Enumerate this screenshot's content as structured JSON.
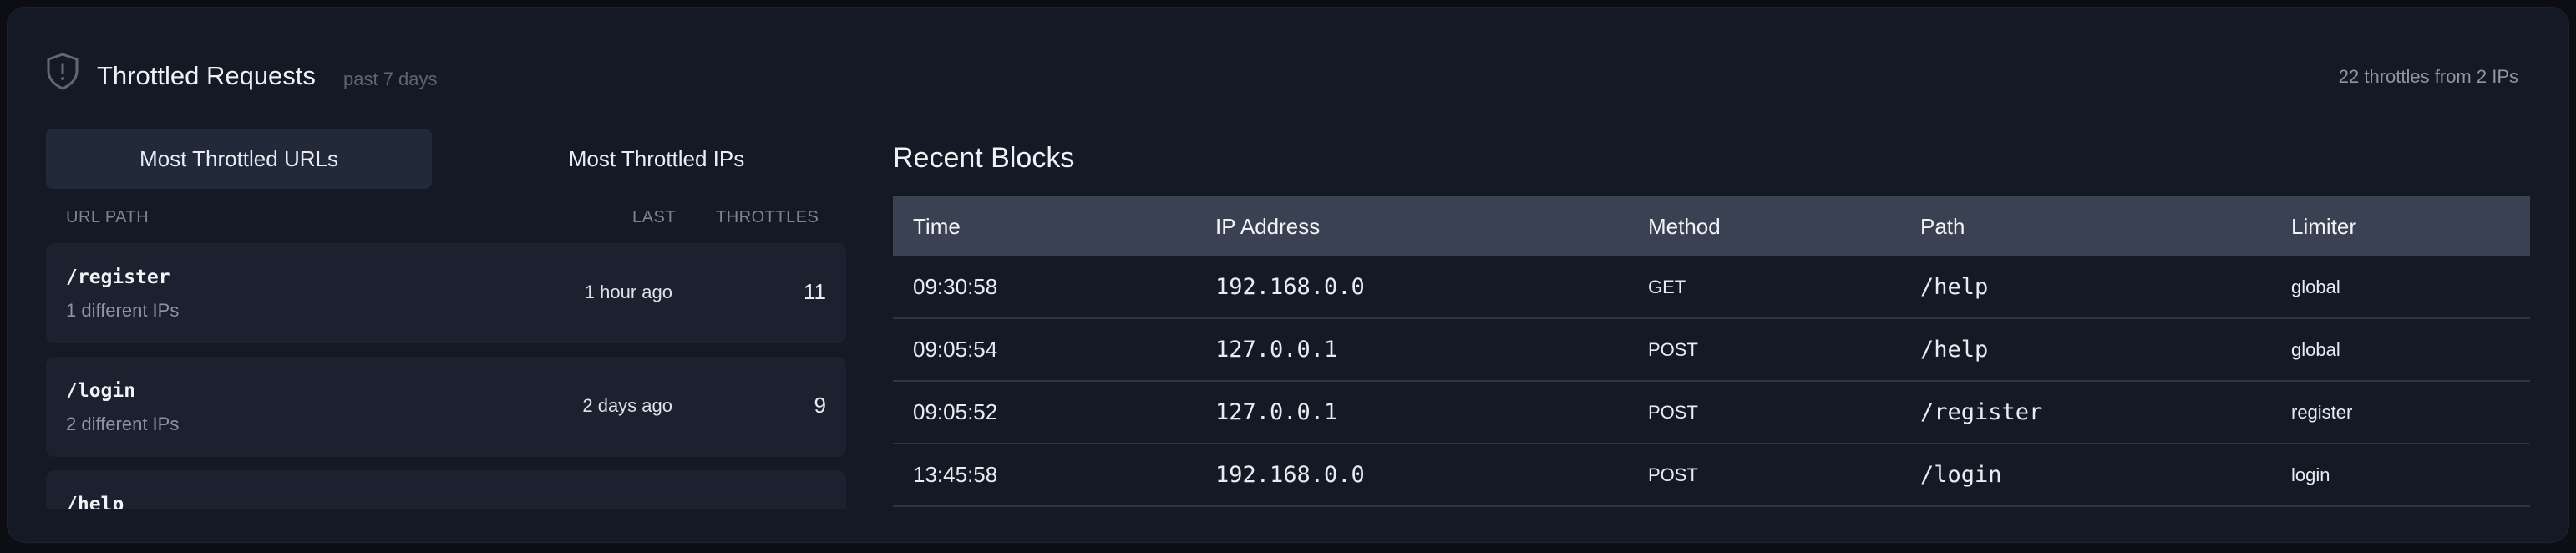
{
  "header": {
    "title": "Throttled Requests",
    "subtitle": "past 7 days",
    "summary": "22 throttles from 2 IPs",
    "icon": "shield-alert-icon"
  },
  "tabs": [
    {
      "label": "Most Throttled URLs",
      "active": true
    },
    {
      "label": "Most Throttled IPs",
      "active": false
    }
  ],
  "list": {
    "columns": {
      "path": "URL PATH",
      "last": "LAST",
      "throttles": "THROTTLES"
    },
    "items": [
      {
        "path": "/register",
        "ips": "1 different IPs",
        "last": "1 hour ago",
        "count": "11"
      },
      {
        "path": "/login",
        "ips": "2 different IPs",
        "last": "2 days ago",
        "count": "9"
      },
      {
        "path": "/help",
        "ips": "",
        "last": "",
        "count": ""
      }
    ]
  },
  "recent": {
    "title": "Recent Blocks",
    "columns": {
      "time": "Time",
      "ip": "IP Address",
      "method": "Method",
      "path": "Path",
      "limiter": "Limiter"
    },
    "rows": [
      {
        "time": "09:30:58",
        "ip": "192.168.0.0",
        "method": "GET",
        "path": "/help",
        "limiter": "global"
      },
      {
        "time": "09:05:54",
        "ip": "127.0.0.1",
        "method": "POST",
        "path": "/help",
        "limiter": "global"
      },
      {
        "time": "09:05:52",
        "ip": "127.0.0.1",
        "method": "POST",
        "path": "/register",
        "limiter": "register"
      },
      {
        "time": "13:45:58",
        "ip": "192.168.0.0",
        "method": "POST",
        "path": "/login",
        "limiter": "login"
      }
    ]
  },
  "colors": {
    "background": "#0c0e14",
    "card": "#141925",
    "active_tab": "#222938",
    "row": "#1c2130",
    "table_header": "#3a4152"
  }
}
